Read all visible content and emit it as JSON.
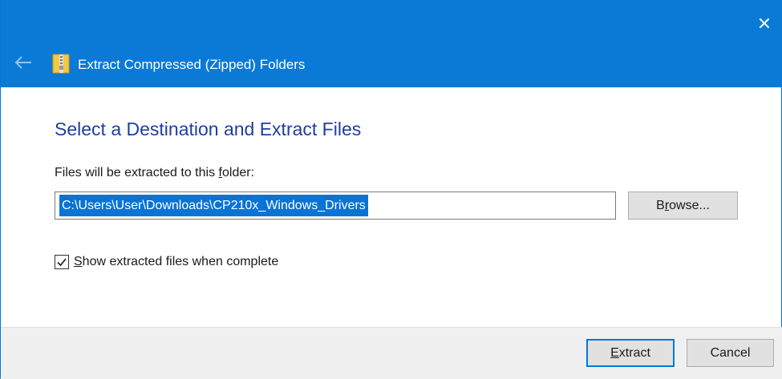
{
  "window": {
    "title": "Extract Compressed (Zipped) Folders",
    "close_glyph": "✕",
    "titlebar_color": "#0a7ad6"
  },
  "icons": {
    "back": "back-arrow-icon",
    "folder": "zipped-folder-icon",
    "close": "close-icon",
    "checkbox": "checkmark-icon"
  },
  "main": {
    "heading": "Select a Destination and Extract Files",
    "heading_color": "#1e3f9e",
    "field_label_pre": "Files will be extracted to this ",
    "field_label_accel": "f",
    "field_label_post": "older:",
    "path_value": "C:\\Users\\User\\Downloads\\CP210x_Windows_Drivers",
    "browse": {
      "pre": "B",
      "accel": "r",
      "post": "owse..."
    },
    "show_files": {
      "checked": true,
      "accel": "S",
      "post": "how extracted files when complete"
    }
  },
  "footer": {
    "extract": {
      "accel": "E",
      "post": "xtract"
    },
    "cancel_label": "Cancel"
  }
}
